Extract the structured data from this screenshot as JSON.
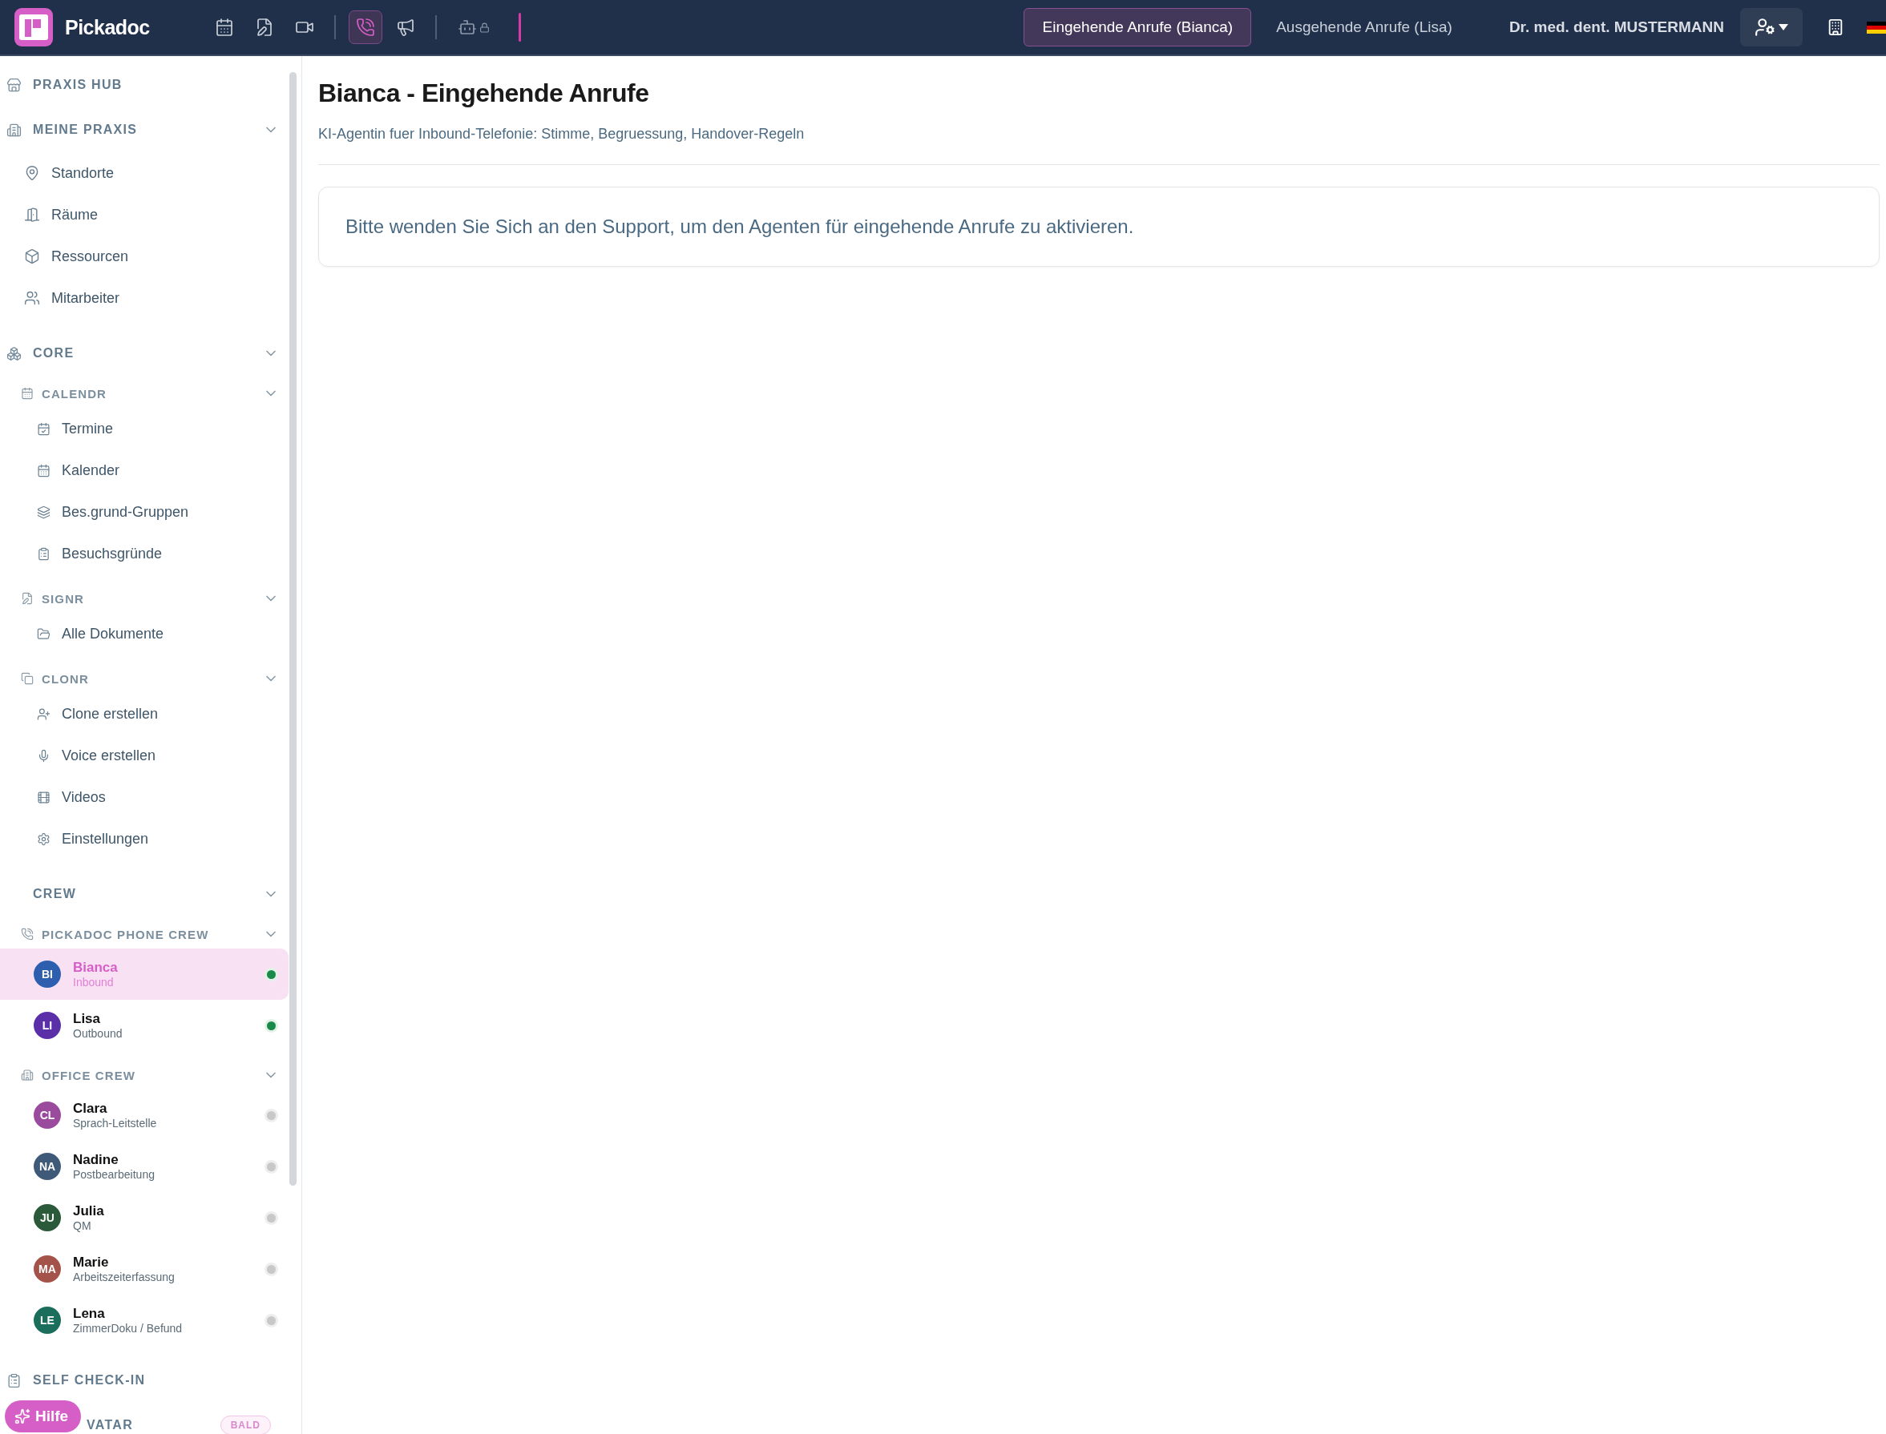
{
  "topbar": {
    "brand": "Pickadoc",
    "tools": [
      {
        "kind": "calendar",
        "selected": false
      },
      {
        "kind": "sign",
        "selected": false
      },
      {
        "kind": "video",
        "selected": false
      },
      {
        "kind": "separator"
      },
      {
        "kind": "phone",
        "selected": true
      },
      {
        "kind": "megaphone",
        "selected": false
      },
      {
        "kind": "separator"
      },
      {
        "kind": "robot",
        "selected": false,
        "locked": true
      }
    ],
    "tabs": [
      {
        "label": "Eingehende Anrufe (Bianca)",
        "selected": true
      },
      {
        "label": "Ausgehende Anrufe (Lisa)",
        "selected": false
      }
    ],
    "user": "Dr. med. dent. MUSTERMANN"
  },
  "sidebar": [
    {
      "kind": "section",
      "label": "PRAXIS HUB"
    },
    {
      "kind": "section",
      "label": "MEINE PRAXIS",
      "expanded": true,
      "children": [
        {
          "kind": "link",
          "label": "Standorte"
        },
        {
          "kind": "link",
          "label": "Räume"
        },
        {
          "kind": "link",
          "label": "Ressourcen"
        },
        {
          "kind": "link",
          "label": "Mitarbeiter"
        }
      ]
    },
    {
      "kind": "section",
      "label": "CORE",
      "expanded": true,
      "children": [
        {
          "kind": "group",
          "label": "CALENDR",
          "expanded": true,
          "children": [
            {
              "kind": "link",
              "label": "Termine"
            },
            {
              "kind": "link",
              "label": "Kalender"
            },
            {
              "kind": "link",
              "label": "Bes.grund-Gruppen"
            },
            {
              "kind": "link",
              "label": "Besuchsgründe"
            }
          ]
        },
        {
          "kind": "group",
          "label": "SIGNR",
          "expanded": true,
          "children": [
            {
              "kind": "link",
              "label": "Alle Dokumente"
            }
          ]
        },
        {
          "kind": "group",
          "label": "CLONR",
          "expanded": true,
          "children": [
            {
              "kind": "link",
              "label": "Clone erstellen"
            },
            {
              "kind": "link",
              "label": "Voice erstellen"
            },
            {
              "kind": "link",
              "label": "Videos"
            },
            {
              "kind": "link",
              "label": "Einstellungen"
            }
          ]
        }
      ]
    },
    {
      "kind": "section",
      "label": "CREW",
      "expanded": true,
      "children": [
        {
          "kind": "group",
          "label": "PICKADOC PHONE CREW",
          "expanded": true,
          "children": [
            {
              "kind": "agent",
              "initials": "BI",
              "name": "Bianca",
              "role": "Inbound",
              "selected": true,
              "online": true,
              "color": "#2d5fae"
            },
            {
              "kind": "agent",
              "initials": "LI",
              "name": "Lisa",
              "role": "Outbound",
              "selected": false,
              "online": true,
              "color": "#5b2fa8"
            }
          ]
        },
        {
          "kind": "group",
          "label": "OFFICE CREW",
          "expanded": true,
          "children": [
            {
              "kind": "agent",
              "initials": "CL",
              "name": "Clara",
              "role": "Sprach-Leitstelle",
              "selected": false,
              "online": false,
              "color": "#9a4b9e"
            },
            {
              "kind": "agent",
              "initials": "NA",
              "name": "Nadine",
              "role": "Postbearbeitung",
              "selected": false,
              "online": false,
              "color": "#3f5a78"
            },
            {
              "kind": "agent",
              "initials": "JU",
              "name": "Julia",
              "role": "QM",
              "selected": false,
              "online": false,
              "color": "#2a5a3a"
            },
            {
              "kind": "agent",
              "initials": "MA",
              "name": "Marie",
              "role": "Arbeitszeiterfassung",
              "selected": false,
              "online": false,
              "color": "#a4534a"
            },
            {
              "kind": "agent",
              "initials": "LE",
              "name": "Lena",
              "role": "ZimmerDoku / Befund",
              "selected": false,
              "online": false,
              "color": "#1c6e5c"
            }
          ]
        }
      ]
    },
    {
      "kind": "section",
      "label": "SELF CHECK-IN"
    },
    {
      "kind": "section",
      "label": "VATAR",
      "badge": "BALD",
      "covered": true
    }
  ],
  "help": "Hilfe",
  "main": {
    "title": "Bianca - Eingehende Anrufe",
    "subtitle": "KI-Agentin fuer Inbound-Telefonie: Stimme, Begruessung, Handover-Regeln",
    "notice": "Bitte wenden Sie Sich an den Support, um den Agenten für eingehende Anrufe zu aktivieren."
  }
}
